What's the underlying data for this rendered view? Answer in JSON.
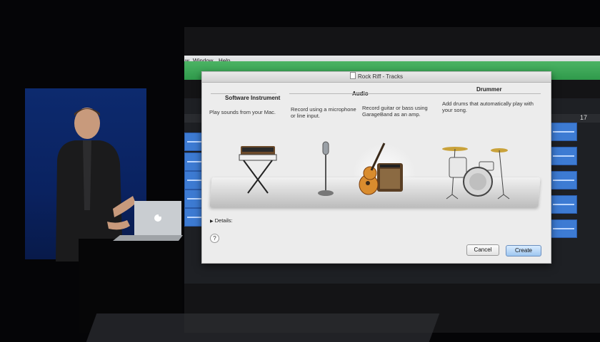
{
  "menubar": {
    "items": [
      "w",
      "Window",
      "Help"
    ]
  },
  "window": {
    "title": "Rock Riff - Tracks"
  },
  "ruler": {
    "bar_number": "17"
  },
  "dialog": {
    "columns": [
      {
        "heading": "Software Instrument",
        "description": "Play sounds from your Mac."
      },
      {
        "heading": "Audio",
        "description_mic": "Record using a microphone or line input.",
        "description_guitar": "Record guitar or bass using GarageBand as an amp."
      },
      {
        "heading": "Drummer",
        "description": "Add drums that automatically play with your song."
      }
    ],
    "details_label": "Details:",
    "help_label": "?",
    "cancel_label": "Cancel",
    "create_label": "Create"
  },
  "icons": [
    "keyboard-synth-icon",
    "microphone-icon",
    "guitar-amp-icon",
    "drum-kit-icon",
    "apple-logo-icon"
  ]
}
